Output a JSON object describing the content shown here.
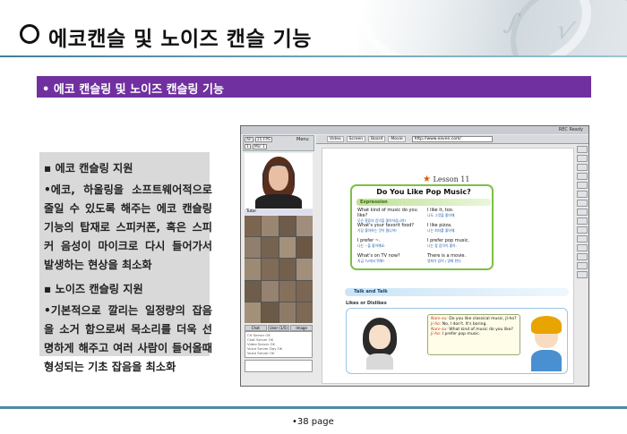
{
  "slide": {
    "title": "에코캔슬 및 노이즈 캔슬 기능",
    "section_heading": "• 에코 캔슬링 및 노이즈 캔슬링 기능",
    "page_label": "•38 page",
    "colors": {
      "section_bar": "#7030a0",
      "rule": "#3f7f98",
      "text_panel": "#d9d9d9"
    }
  },
  "features": [
    {
      "heading": "▪ 에코 캔슬링 지원",
      "body": "•에코, 하울링을 소프트웨어적으로 줄일 수 있도록 해주는 에코 캔슬링 기능의 탑재로 스피커폰, 혹은 스피커 음성이 마이크로 다시 들어가서 발생하는 현상을 최소화"
    },
    {
      "heading": "▪ 노이즈 캔슬링 지원",
      "body": "•기본적으로 깔리는 일정량의 잡음을 소거 함으로써 목소리를 더욱 선명하게 해주고 여러 사람이 들어올때 형성되는 기초 잡음을 최소화"
    }
  ],
  "screenshot": {
    "status": "REC Ready",
    "left_tools": [
      "All",
      "15 FPS",
      "1",
      "Mic 1"
    ],
    "menu_label": "Menu",
    "tutor_label": "Tutor",
    "chat_tabs": [
      "Chat",
      "User (1/5)",
      "Image"
    ],
    "chat_log": [
      "CH Server OK",
      "Chat Server OK",
      "Video Server OK",
      "Voice Server Day OK",
      "Voice Server OK"
    ],
    "nav_buttons": [
      "Video",
      "Screen",
      "Board",
      "Movie"
    ],
    "url": "http://www.eaven.com/",
    "lesson": {
      "badge": "Lesson 11",
      "title": "Do You Like Pop Music?",
      "expression_tag": "Expression",
      "rows": [
        {
          "left_en": "What kind of music do you like?",
          "left_ko": "무슨 종류의 음악을 좋아하십니까?",
          "right_en": "I like it, too.",
          "right_ko": "나도 그것을 좋아해."
        },
        {
          "left_en": "What's your favorit food?",
          "left_ko": "가장 좋아하는 것이 뭡니까?",
          "right_en": "I like pizza.",
          "right_ko": "나는 피자를 좋아해."
        },
        {
          "left_en": "I prefer ~.",
          "left_ko": "나는 ~을 좋아해요.",
          "right_en": "I prefer pop music.",
          "right_ko": "나는 팝 음악이 좋아."
        },
        {
          "left_en": "What's on TV now?",
          "left_ko": "지금 TV에서 뭐해?",
          "right_en": "There is a movie.",
          "right_ko": "영화가 있어 / 영화 한다."
        }
      ],
      "talk_tag": "Talk and Talk",
      "likes_label": "Likes or Dislikes",
      "dialog": [
        {
          "speaker": "Nam-su:",
          "line": "Do you like classical music, Ji-ho?"
        },
        {
          "speaker": "Ji-ho:",
          "line": "No, I don't. It's boring."
        },
        {
          "speaker": "Nam-su:",
          "line": "What kind of music do you like?"
        },
        {
          "speaker": "Ji-ho:",
          "line": "I prefer pop music."
        }
      ]
    }
  }
}
